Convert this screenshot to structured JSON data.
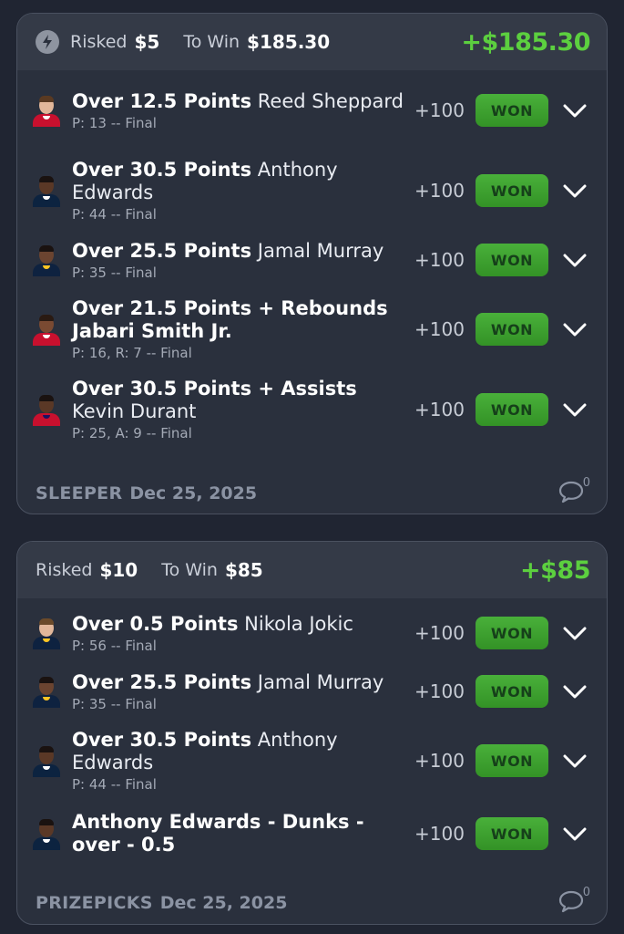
{
  "colors": {
    "background": "#202532",
    "card": "#2a303d",
    "header": "#343a47",
    "profit_green": "#5ccf3f",
    "won_badge": "#3ea32f",
    "muted": "#8b93a3"
  },
  "slips": [
    {
      "header": {
        "icon": "lightning-bolt-icon",
        "risked_label": "Risked",
        "risked_value": "$5",
        "to_win_label": "To Win",
        "to_win_value": "$185.30",
        "payout": "+$185.30"
      },
      "legs": [
        {
          "market": "Over 12.5 Points",
          "player": "Reed Sheppard",
          "stats": "P: 13 -- Final",
          "odds": "+100",
          "result": "WON",
          "team_color": "#c8102e"
        },
        {
          "market": "Over 30.5 Points",
          "player": "Anthony Edwards",
          "stats": "P: 44 -- Final",
          "odds": "+100",
          "result": "WON",
          "team_color": "#0c2340"
        },
        {
          "market": "Over 25.5 Points",
          "player": "Jamal Murray",
          "stats": "P: 35 -- Final",
          "odds": "+100",
          "result": "WON",
          "team_color": "#0e2240"
        },
        {
          "market": "Over 21.5 Points + Rebounds",
          "player": "Jabari Smith Jr.",
          "stats": "P: 16,  R: 7 -- Final",
          "odds": "+100",
          "result": "WON",
          "team_color": "#c8102e"
        },
        {
          "market": "Over 30.5 Points + Assists",
          "player": "Kevin Durant",
          "stats": "P: 25,  A: 9 -- Final",
          "odds": "+100",
          "result": "WON",
          "team_color": "#c8102e"
        }
      ],
      "footer": {
        "book": "SLEEPER",
        "date": "Dec 25, 2025",
        "comment_count": "0"
      }
    },
    {
      "header": {
        "risked_label": "Risked",
        "risked_value": "$10",
        "to_win_label": "To Win",
        "to_win_value": "$85",
        "payout": "+$85"
      },
      "legs": [
        {
          "market": "Over 0.5 Points",
          "player": "Nikola Jokic",
          "stats": "P: 56 -- Final",
          "odds": "+100",
          "result": "WON",
          "team_color": "#0e2240"
        },
        {
          "market": "Over 25.5 Points",
          "player": "Jamal Murray",
          "stats": "P: 35 -- Final",
          "odds": "+100",
          "result": "WON",
          "team_color": "#0e2240"
        },
        {
          "market": "Over 30.5 Points",
          "player": "Anthony Edwards",
          "stats": "P: 44 -- Final",
          "odds": "+100",
          "result": "WON",
          "team_color": "#0c2340"
        },
        {
          "market": "Anthony Edwards - Dunks - over - 0.5",
          "player": "",
          "stats": "",
          "odds": "+100",
          "result": "WON",
          "team_color": "#0c2340"
        }
      ],
      "footer": {
        "book": "PRIZEPICKS",
        "date": "Dec 25, 2025",
        "comment_count": "0"
      }
    }
  ]
}
